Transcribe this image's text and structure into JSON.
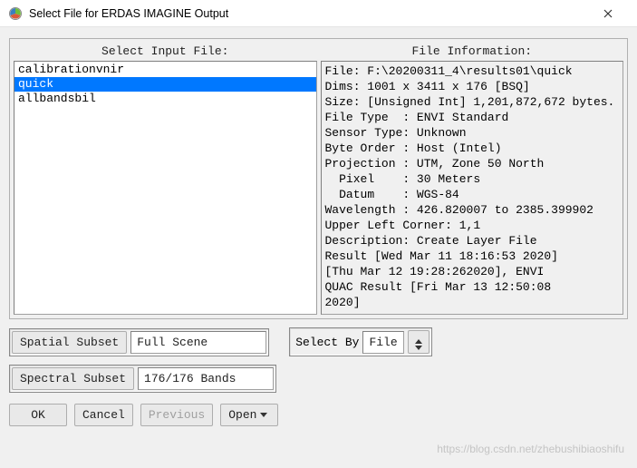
{
  "window": {
    "title": "Select File for ERDAS IMAGINE Output"
  },
  "left": {
    "heading": "Select Input File:",
    "items": [
      "calibrationvnir",
      "quick",
      "allbandsbil"
    ],
    "selectedIndex": 1
  },
  "right": {
    "heading": "File Information:",
    "lines": [
      "File: F:\\20200311_4\\results01\\quick",
      "Dims: 1001 x 3411 x 176 [BSQ]",
      "Size: [Unsigned Int] 1,201,872,672 bytes.",
      "File Type  : ENVI Standard",
      "Sensor Type: Unknown",
      "Byte Order : Host (Intel)",
      "Projection : UTM, Zone 50 North",
      "  Pixel    : 30 Meters",
      "  Datum    : WGS-84",
      "Wavelength : 426.820007 to 2385.399902",
      "Upper Left Corner: 1,1",
      "Description: Create Layer File",
      "Result [Wed Mar 11 18:16:53 2020]",
      "[Thu Mar 12 19:28:262020], ENVI",
      "QUAC Result [Fri Mar 13 12:50:08",
      "2020]"
    ]
  },
  "spatial": {
    "label": "Spatial Subset",
    "value": "Full Scene"
  },
  "selectBy": {
    "label": "Select By",
    "value": "File"
  },
  "spectral": {
    "label": "Spectral Subset",
    "value": "176/176 Bands"
  },
  "buttons": {
    "ok": "OK",
    "cancel": "Cancel",
    "previous": "Previous",
    "open": "Open"
  },
  "watermark": "https://blog.csdn.net/zhebushibiaoshifu"
}
